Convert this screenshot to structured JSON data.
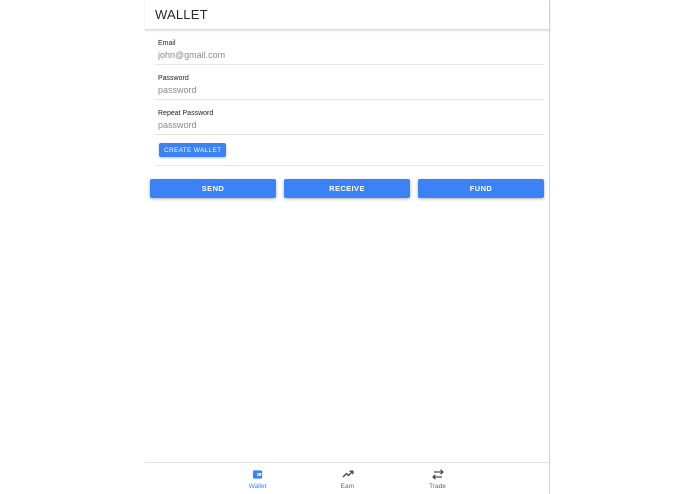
{
  "header": {
    "title": "WALLET"
  },
  "form": {
    "email": {
      "label": "Email",
      "placeholder": "john@gmail.com"
    },
    "password": {
      "label": "Password",
      "placeholder": "password"
    },
    "repeat_password": {
      "label": "Repeat Password",
      "placeholder": "password"
    },
    "create_label": "CREATE WALLET"
  },
  "actions": {
    "send": "SEND",
    "receive": "RECEIVE",
    "fund": "FUND"
  },
  "tabs": [
    {
      "label": "Wallet",
      "icon": "wallet-icon",
      "active": true
    },
    {
      "label": "Earn",
      "icon": "trending-up-icon",
      "active": false
    },
    {
      "label": "Trade",
      "icon": "swap-arrows-icon",
      "active": false
    }
  ],
  "colors": {
    "accent": "#3b82f6",
    "tab_inactive": "#666666"
  }
}
